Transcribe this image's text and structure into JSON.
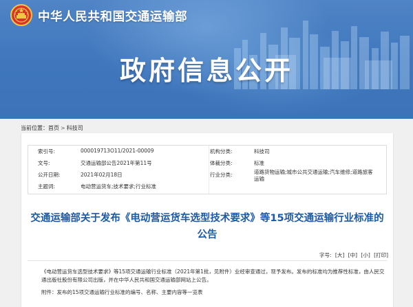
{
  "header": {
    "ministry_name": "中华人民共和国交通运输部",
    "banner_title": "政府信息公开"
  },
  "breadcrumb": {
    "prefix": "当前位置：",
    "items": [
      "首页",
      "科技司"
    ],
    "separator": ">"
  },
  "meta": {
    "index_label": "索引号:",
    "index_value": "000019713O11/2021-00009",
    "issuer_label": "机构分类:",
    "issuer_value": "科技司",
    "docno_label": "文号:",
    "docno_value": "交通运输部公告2021年第11号",
    "genre_label": "体裁分类:",
    "genre_value": "标准",
    "date_label": "公开日期:",
    "date_value": "2021年02月18日",
    "industry_label": "行业分类:",
    "industry_value": "道路货物运输;城市公共交通运输;汽车维修;道路旅客运输",
    "subject_label": "主题词:",
    "subject_value": "电动营运货车;技术要求;行业标准"
  },
  "article": {
    "title": "交通运输部关于发布《电动营运货车选型技术要求》等15项交通运输行业标准的公告",
    "paragraph1": "《电动营运货车选型技术要求》等15项交通运输行业标准（2021年第1批，见附件）业经审查通过，现予发布。发布的标准均为推荐性标准，由人民交通出版社股份有限公司出版，并在中华人民共和国交通运输部网站上公告。",
    "paragraph2": "附件：发布的15项交通运输行业标准的编号、名称、主要内容等一览表"
  },
  "fontbar": {
    "label": "字号:",
    "large": "[大]",
    "medium": "[中]",
    "small": "[小]",
    "print": "[打印]"
  },
  "colors": {
    "banner_blue": "#3f76bc",
    "title_blue": "#1c5aa7",
    "gray_bg": "#f0f0f0"
  }
}
